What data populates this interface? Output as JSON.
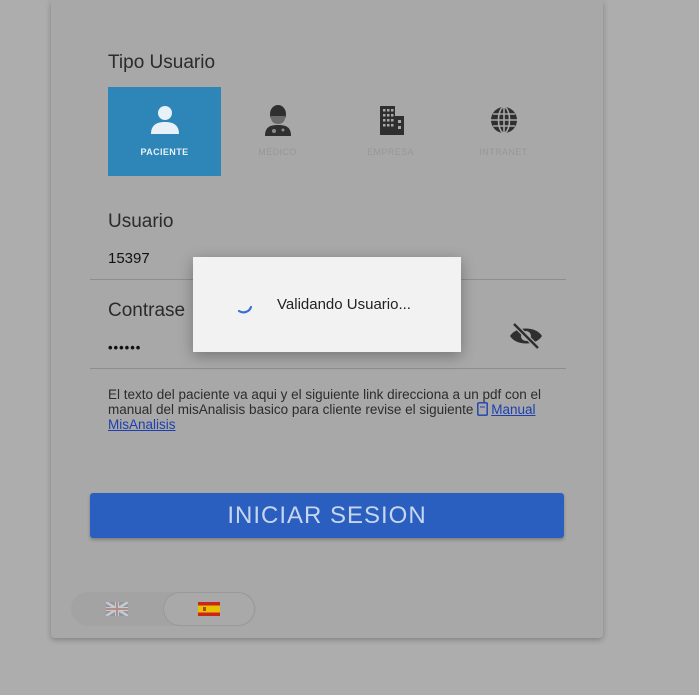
{
  "login": {
    "user_type_title": "Tipo Usuario",
    "user_types": [
      {
        "label": "PACIENTE",
        "icon": "person-icon",
        "active": true
      },
      {
        "label": "MÉDICO",
        "icon": "doctor-icon",
        "active": false
      },
      {
        "label": "EMPRESA",
        "icon": "building-icon",
        "active": false
      },
      {
        "label": "INTRANET",
        "icon": "globe-icon",
        "active": false
      }
    ],
    "username_label": "Usuario",
    "username_value": "15397",
    "password_label": "Contrase",
    "password_value": "••••••",
    "note_text": "El texto del paciente va aqui y el siguiente link direcciona a un pdf con el manual del misAnalisis basico para cliente revise el siguiente",
    "manual_link": "Manual MisAnalisis",
    "submit_label": "INICIAR SESION",
    "languages": [
      {
        "code": "en",
        "icon": "uk-flag-icon",
        "active": false
      },
      {
        "code": "es",
        "icon": "spain-flag-icon",
        "active": true
      }
    ]
  },
  "dialog": {
    "message": "Validando Usuario..."
  },
  "colors": {
    "accent": "#2e86b8",
    "button": "#2a5fbf",
    "backdrop": "#adadad"
  }
}
